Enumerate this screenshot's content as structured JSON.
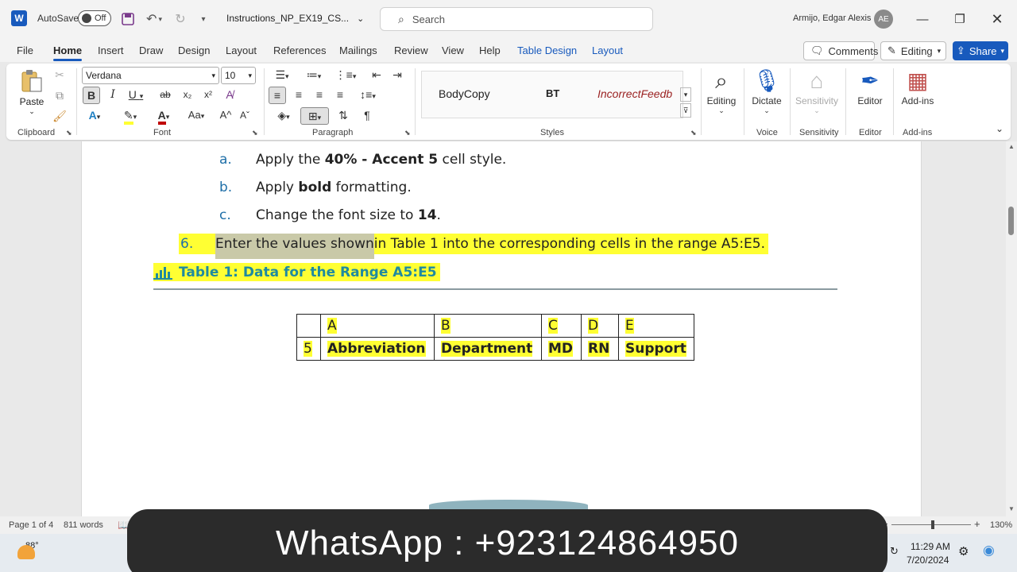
{
  "titlebar": {
    "app_logo": "W",
    "autosave_label": "AutoSave",
    "autosave_state": "Off",
    "doc_title": "Instructions_NP_EX19_CS...",
    "search_placeholder": "Search",
    "user_name": "Armijo, Edgar Alexis",
    "avatar_initials": "AE"
  },
  "menu": {
    "tabs": [
      "File",
      "Home",
      "Insert",
      "Draw",
      "Design",
      "Layout",
      "References",
      "Mailings",
      "Review",
      "View",
      "Help",
      "Table Design",
      "Layout"
    ],
    "active_tab": "Home",
    "comments_label": "Comments",
    "editing_label": "Editing",
    "share_label": "Share"
  },
  "ribbon": {
    "clipboard": {
      "paste_label": "Paste",
      "group_label": "Clipboard"
    },
    "font": {
      "font_name": "Verdana",
      "font_size": "10",
      "group_label": "Font"
    },
    "paragraph": {
      "group_label": "Paragraph"
    },
    "styles": {
      "items": [
        "BodyCopy",
        "BT",
        "IncorrectFeedb"
      ],
      "group_label": "Styles"
    },
    "editing": {
      "label": "Editing"
    },
    "voice": {
      "dictate_label": "Dictate",
      "group_label": "Voice"
    },
    "sensitivity": {
      "label": "Sensitivity",
      "group_label": "Sensitivity"
    },
    "editor": {
      "label": "Editor",
      "group_label": "Editor"
    },
    "addins": {
      "label": "Add-ins",
      "group_label": "Add-ins"
    }
  },
  "document": {
    "substeps": [
      {
        "letter": "a.",
        "pre": "Apply the ",
        "bold": "40% - Accent 5",
        "post": " cell style."
      },
      {
        "letter": "b.",
        "pre": "Apply ",
        "bold": "bold",
        "post": " formatting."
      },
      {
        "letter": "c.",
        "pre": "Change the font size to ",
        "bold": "14",
        "post": "."
      }
    ],
    "step6": {
      "number": "6.",
      "selected_text": "Enter the values shown",
      "rest_text": " in Table 1 into the corresponding cells in the range A5:E5."
    },
    "caption": "Table 1: Data for the Range A5:E5",
    "table": {
      "headers": [
        "",
        "A",
        "B",
        "C",
        "D",
        "E"
      ],
      "row": [
        "5",
        "Abbreviation",
        "Department",
        "MD",
        "RN",
        "Support"
      ]
    }
  },
  "statusbar": {
    "page_info": "Page 1 of 4",
    "word_count": "811 words",
    "zoom": "130%"
  },
  "taskbar": {
    "temperature": "88°",
    "time": "11:29 AM",
    "date": "7/20/2024"
  },
  "overlay": {
    "text": "WhatsApp : +923124864950"
  }
}
